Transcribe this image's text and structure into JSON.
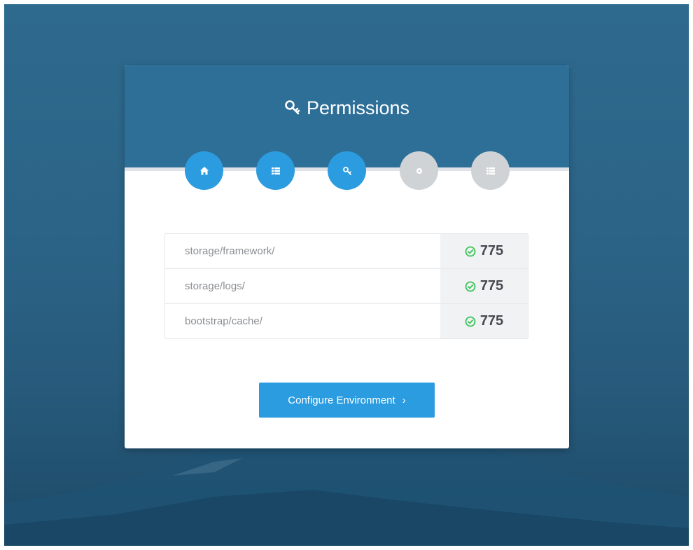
{
  "installer": {
    "title": "Permissions",
    "title_icon": "key-icon",
    "steps": [
      {
        "icon": "home-icon",
        "state": "completed"
      },
      {
        "icon": "list-icon",
        "state": "completed"
      },
      {
        "icon": "key-icon",
        "state": "active"
      },
      {
        "icon": "gear-icon",
        "state": "pending"
      },
      {
        "icon": "list-icon",
        "state": "pending"
      }
    ],
    "permissions": [
      {
        "path": "storage/framework/",
        "value": "775",
        "status": "ok"
      },
      {
        "path": "storage/logs/",
        "value": "775",
        "status": "ok"
      },
      {
        "path": "bootstrap/cache/",
        "value": "775",
        "status": "ok"
      }
    ],
    "next_button": {
      "label": "Configure Environment",
      "chevron": "›"
    }
  },
  "colors": {
    "header": "#2e6f98",
    "accent": "#2c9ce0",
    "inactive_step": "#cfd3d6",
    "check_ok": "#3cc35a",
    "background": "#2b6386"
  }
}
